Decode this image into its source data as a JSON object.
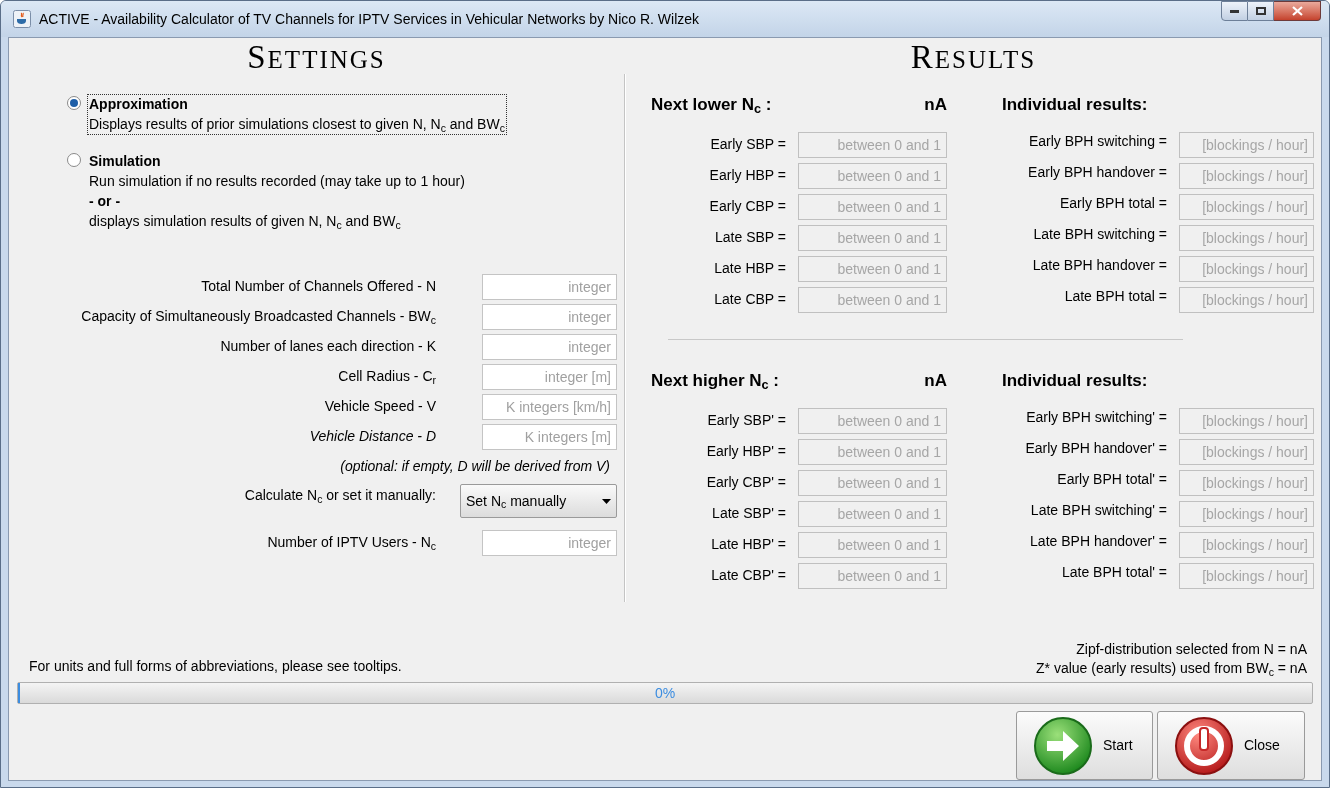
{
  "window": {
    "title": "ACTIVE - Availability Calculator of TV Channels for IPTV Services in Vehicular Networks by Nico R. Wilzek"
  },
  "settings": {
    "heading": "SETTINGS",
    "modes": [
      {
        "label": "Approximation",
        "selected": true,
        "focused": true,
        "lines": [
          {
            "text": "Displays results of prior simulations closest to given N, N$_{c}$ and BW$_{c}$",
            "bold": false
          }
        ]
      },
      {
        "label": "Simulation",
        "selected": false,
        "focused": false,
        "lines": [
          {
            "text": "Run simulation if no results recorded (may take up to 1 hour)",
            "bold": false
          },
          {
            "text": "- or -",
            "bold": true
          },
          {
            "text": "displays simulation results of given N, N$_{c}$ and BW$_{c}$",
            "bold": false
          }
        ]
      }
    ],
    "fields": [
      {
        "kind": "input",
        "label": "Total Number of Channels Offered - N",
        "placeholder": "integer",
        "italic": false
      },
      {
        "kind": "input",
        "label": "Capacity of Simultaneously Broadcasted Channels - BW$_{c}$",
        "placeholder": "integer",
        "italic": false
      },
      {
        "kind": "input",
        "label": "Number of lanes each direction - K",
        "placeholder": "integer",
        "italic": false
      },
      {
        "kind": "input",
        "label": "Cell Radius - C$_{r}$",
        "placeholder": "integer [m]",
        "italic": false
      },
      {
        "kind": "input",
        "label": "Vehicle Speed - V",
        "placeholder": "K integers [km/h]",
        "italic": false
      },
      {
        "kind": "input",
        "label": "Vehicle Distance - D",
        "placeholder": "K integers [m]",
        "italic": true
      },
      {
        "kind": "note",
        "label": "(optional: if empty, D will be derived from V)"
      },
      {
        "kind": "dropdown",
        "label": "Calculate N$_{c}$ or set it manually:",
        "value": "Set N$_{c}$ manually"
      },
      {
        "kind": "input",
        "label": "Number of IPTV Users - N$_{c}$",
        "placeholder": "integer",
        "italic": false
      }
    ]
  },
  "results": {
    "heading": "RESULTS",
    "sections": [
      {
        "label": "Next lower N$_{c}$ :",
        "value": "nA",
        "individual_heading": "Individual results:",
        "probabilities": [
          {
            "label": "Early SBP =",
            "placeholder": "between 0 and 1"
          },
          {
            "label": "Early HBP =",
            "placeholder": "between 0 and 1"
          },
          {
            "label": "Early CBP =",
            "placeholder": "between 0 and 1"
          },
          {
            "label": "Late SBP =",
            "placeholder": "between 0 and 1"
          },
          {
            "label": "Late HBP =",
            "placeholder": "between 0 and 1"
          },
          {
            "label": "Late CBP =",
            "placeholder": "between 0 and 1"
          }
        ],
        "blockings": [
          {
            "label": "Early BPH switching =",
            "placeholder": "[blockings / hour]"
          },
          {
            "label": "Early BPH handover =",
            "placeholder": "[blockings / hour]"
          },
          {
            "label": "Early BPH total =",
            "placeholder": "[blockings / hour]"
          },
          {
            "label": "Late BPH switching =",
            "placeholder": "[blockings / hour]"
          },
          {
            "label": "Late BPH handover =",
            "placeholder": "[blockings / hour]"
          },
          {
            "label": "Late BPH total =",
            "placeholder": "[blockings / hour]"
          }
        ]
      },
      {
        "label": "Next higher N$_{c}$ :",
        "value": "nA",
        "individual_heading": "Individual results:",
        "probabilities": [
          {
            "label": "Early SBP' =",
            "placeholder": "between 0 and 1"
          },
          {
            "label": "Early HBP' =",
            "placeholder": "between 0 and 1"
          },
          {
            "label": "Early CBP' =",
            "placeholder": "between 0 and 1"
          },
          {
            "label": "Late SBP' =",
            "placeholder": "between 0 and 1"
          },
          {
            "label": "Late HBP' =",
            "placeholder": "between 0 and 1"
          },
          {
            "label": "Late CBP' =",
            "placeholder": "between 0 and 1"
          }
        ],
        "blockings": [
          {
            "label": "Early BPH switching' =",
            "placeholder": "[blockings / hour]"
          },
          {
            "label": "Early BPH handover' =",
            "placeholder": "[blockings / hour]"
          },
          {
            "label": "Early BPH total' =",
            "placeholder": "[blockings / hour]"
          },
          {
            "label": "Late BPH switching' =",
            "placeholder": "[blockings / hour]"
          },
          {
            "label": "Late BPH handover' =",
            "placeholder": "[blockings / hour]"
          },
          {
            "label": "Late BPH total' =",
            "placeholder": "[blockings / hour]"
          }
        ]
      }
    ]
  },
  "footer": {
    "note": "For units and full forms of abbreviations, please see tooltips.",
    "info": [
      "Zipf-distribution selected from N = nA",
      "Z* value (early results) used from BW$_{c}$ = nA"
    ],
    "progress": {
      "label": "0%",
      "level": 0
    },
    "buttons": [
      {
        "kind": "start",
        "label": "Start"
      },
      {
        "kind": "close",
        "label": "Close"
      }
    ]
  }
}
